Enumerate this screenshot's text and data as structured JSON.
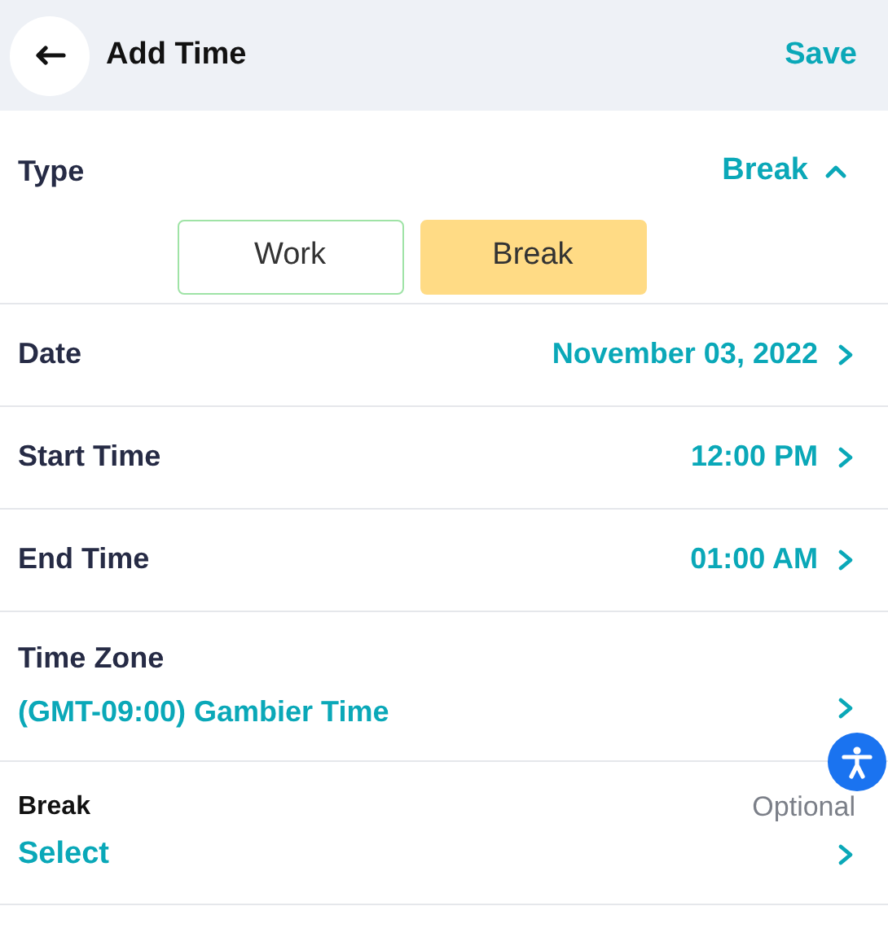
{
  "header": {
    "title": "Add Time",
    "save": "Save"
  },
  "type": {
    "label": "Type",
    "value": "Break",
    "expanded": true,
    "options": [
      {
        "label": "Work",
        "selected": false
      },
      {
        "label": "Break",
        "selected": true
      }
    ]
  },
  "rows": [
    {
      "label": "Date",
      "value": "November 03, 2022"
    },
    {
      "label": "Start Time",
      "value": "12:00 PM"
    },
    {
      "label": "End Time",
      "value": "01:00 AM"
    }
  ],
  "time_zone": {
    "label": "Time Zone",
    "value": "(GMT-09:00) Gambier Time"
  },
  "break": {
    "label": "Break",
    "hint": "Optional",
    "value": "Select"
  }
}
